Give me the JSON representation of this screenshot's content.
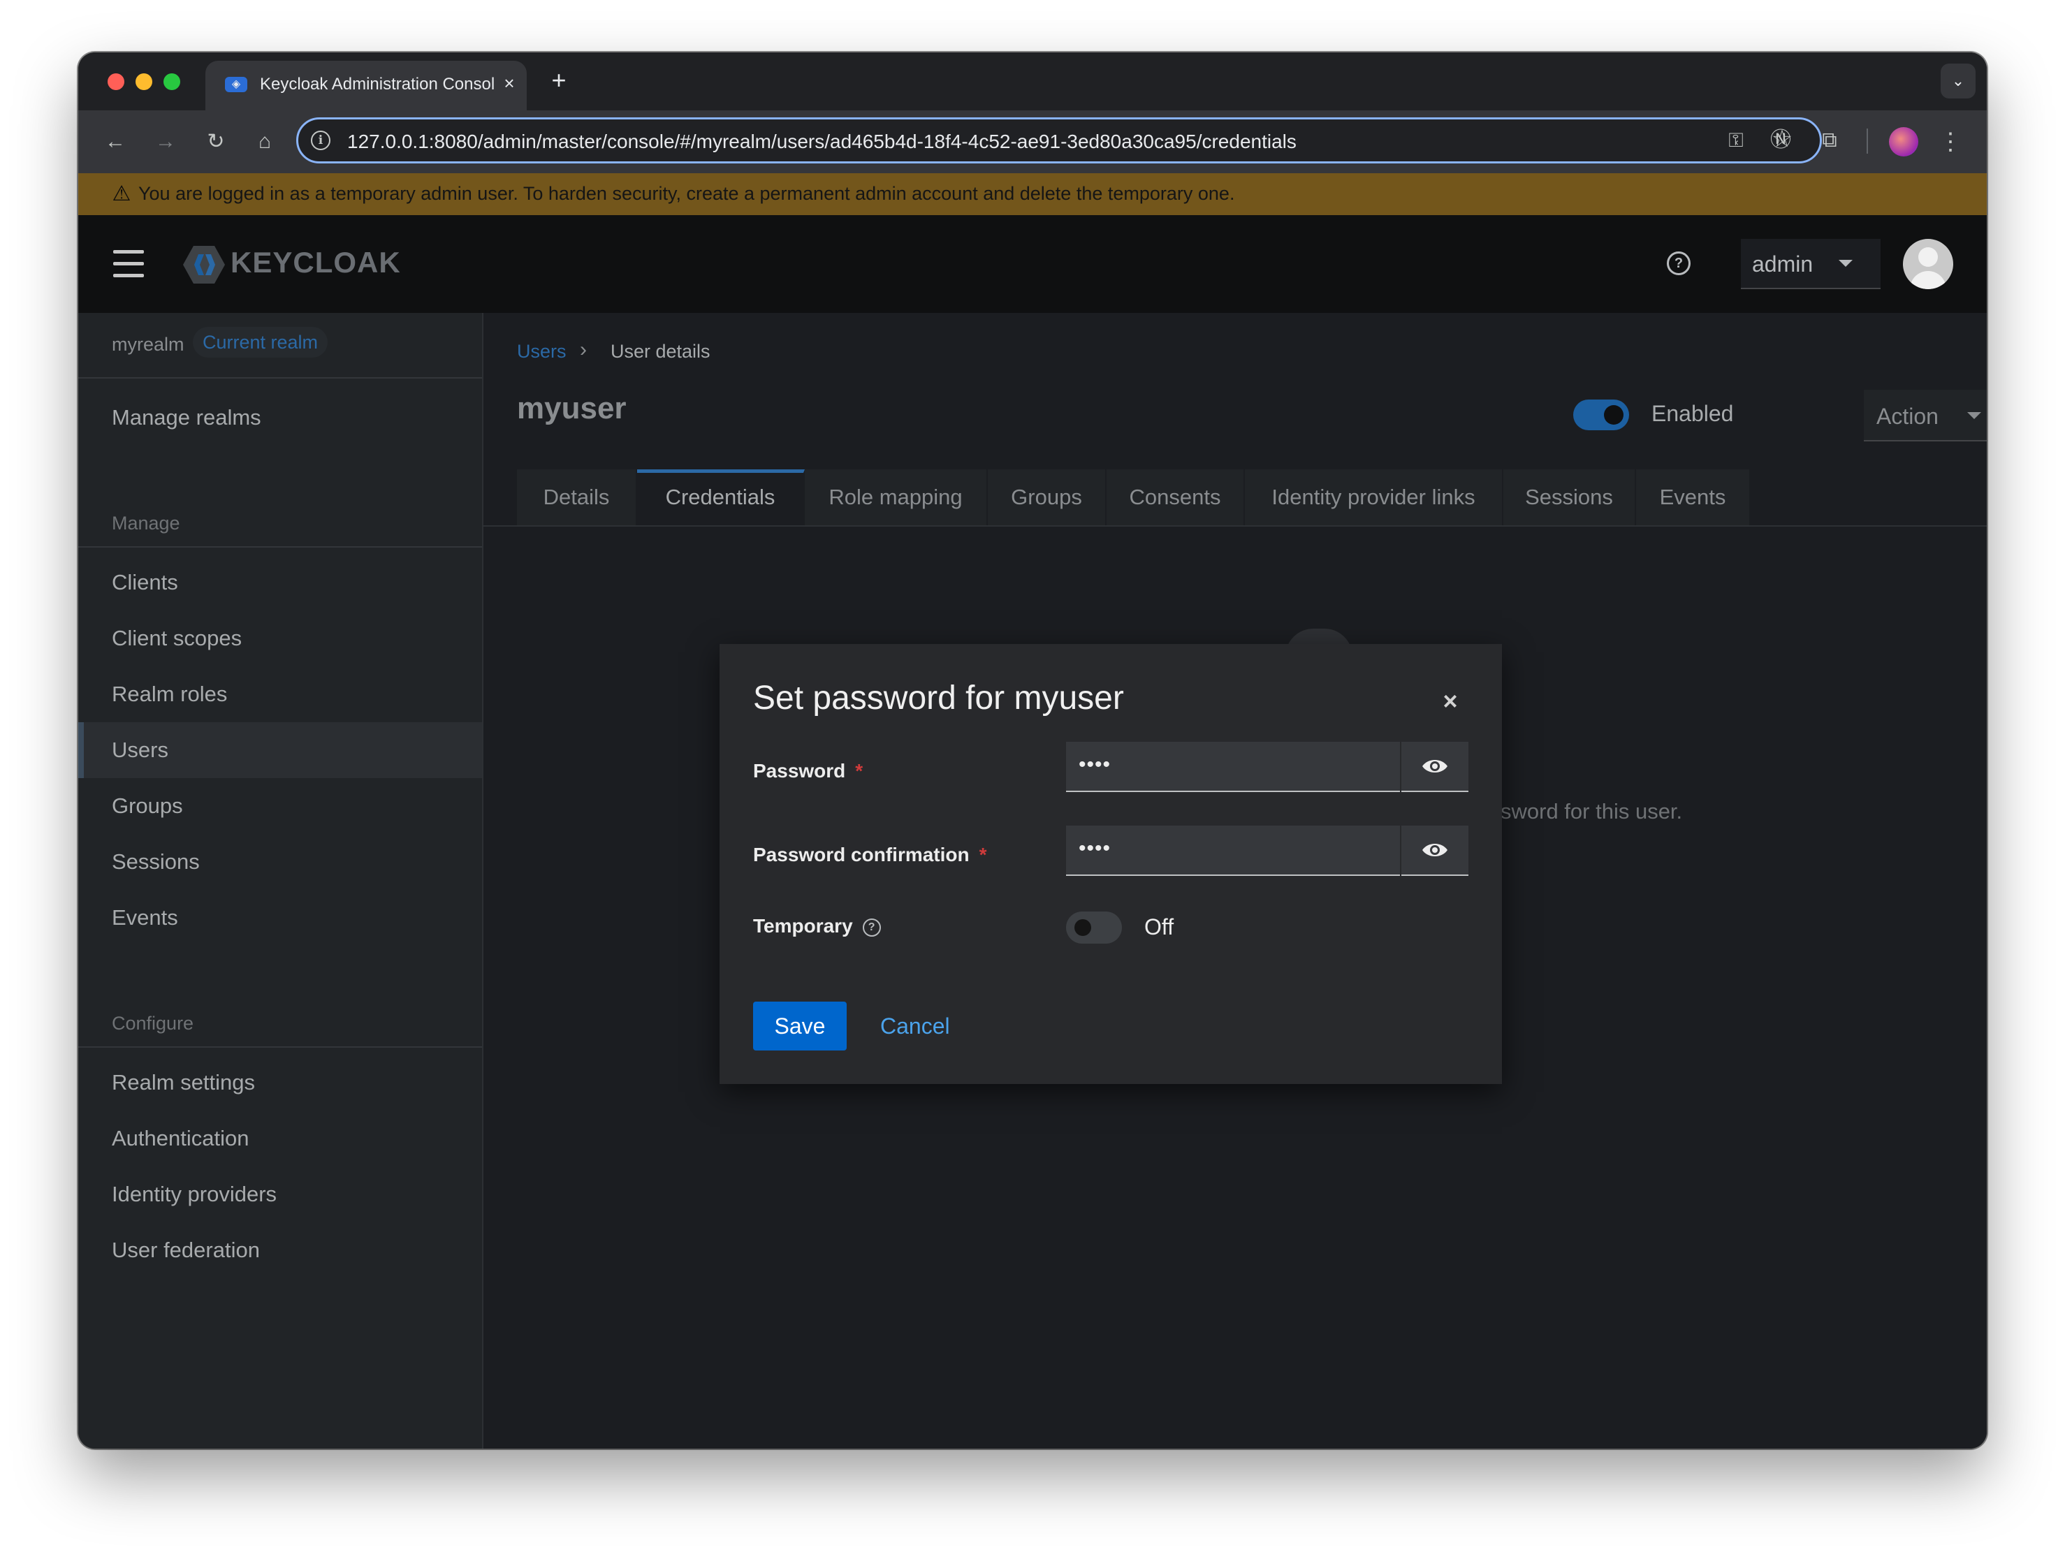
{
  "browser": {
    "tab_title": "Keycloak Administration Console",
    "tab_close": "×",
    "new_tab": "+",
    "url": "127.0.0.1:8080/admin/master/console/#/myrealm/users/ad465b4d-18f4-4c52-ae91-3ed80a30ca95/credentials"
  },
  "banner": {
    "text": "You are logged in as a temporary admin user. To harden security, create a permanent admin account and delete the temporary one."
  },
  "masthead": {
    "logo_text": "KEYCLOAK",
    "user_menu_label": "admin"
  },
  "sidebar": {
    "realm_name": "myrealm",
    "realm_badge": "Current realm",
    "manage_realms": "Manage realms",
    "section_manage": "Manage",
    "manage_items": [
      {
        "label": "Clients"
      },
      {
        "label": "Client scopes"
      },
      {
        "label": "Realm roles"
      },
      {
        "label": "Users",
        "active": true
      },
      {
        "label": "Groups"
      },
      {
        "label": "Sessions"
      },
      {
        "label": "Events"
      }
    ],
    "section_configure": "Configure",
    "configure_items": [
      {
        "label": "Realm settings"
      },
      {
        "label": "Authentication"
      },
      {
        "label": "Identity providers"
      },
      {
        "label": "User federation"
      }
    ]
  },
  "main": {
    "breadcrumb": {
      "parent": "Users",
      "current": "User details"
    },
    "title": "myuser",
    "enabled_label": "Enabled",
    "enabled": true,
    "action_label": "Action",
    "tabs": [
      {
        "label": "Details"
      },
      {
        "label": "Credentials",
        "active": true
      },
      {
        "label": "Role mapping"
      },
      {
        "label": "Groups"
      },
      {
        "label": "Consents"
      },
      {
        "label": "Identity provider links"
      },
      {
        "label": "Sessions"
      },
      {
        "label": "Events"
      }
    ],
    "background_partial_text": "sword for this user."
  },
  "modal": {
    "title": "Set password for myuser",
    "close": "×",
    "password_label": "Password",
    "password_value": "••••",
    "confirm_label": "Password confirmation",
    "confirm_value": "••••",
    "required_marker": "*",
    "temporary_label": "Temporary",
    "help_glyph": "?",
    "temporary_state": "Off",
    "temporary_enabled": false,
    "save_label": "Save",
    "cancel_label": "Cancel"
  },
  "colors": {
    "accent_blue": "#0066cc",
    "link_blue": "#2b69a6",
    "banner_gold": "#73561b",
    "danger_red": "#d03b3b"
  },
  "icons": {
    "back": "arrow-left-icon",
    "forward": "arrow-right-icon",
    "reload": "reload-icon",
    "home": "home-icon",
    "site_info": "info-icon",
    "password_manager": "key-icon",
    "bookmark": "star-icon",
    "warning": "warning-icon",
    "help": "question-circle-icon",
    "show_password": "eye-icon"
  }
}
